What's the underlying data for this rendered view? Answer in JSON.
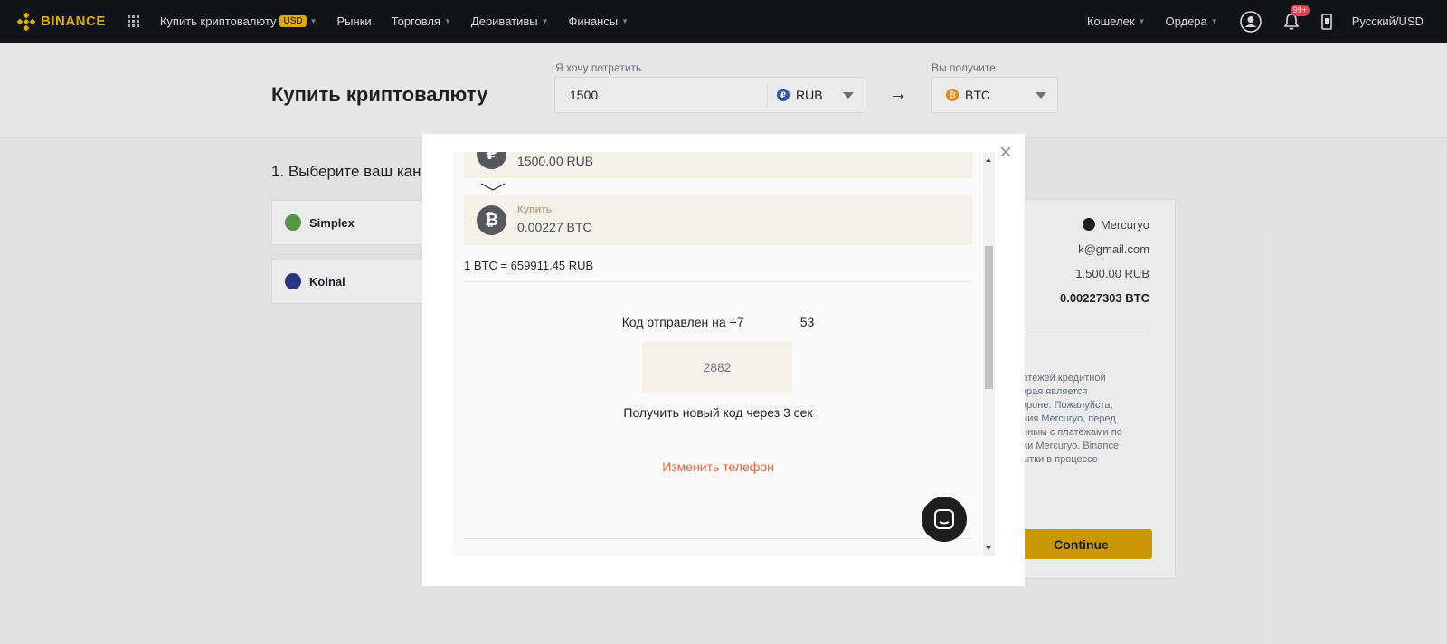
{
  "nav": {
    "logo": "BINANCE",
    "items": [
      {
        "label": "Купить криптовалюту",
        "badge": "USD"
      },
      {
        "label": "Рынки"
      },
      {
        "label": "Торговля"
      },
      {
        "label": "Деривативы"
      },
      {
        "label": "Финансы"
      }
    ],
    "right": {
      "wallet": "Кошелек",
      "orders": "Ордера",
      "notifications": "99+",
      "language": "Русский/USD"
    }
  },
  "header": {
    "title": "Купить криптовалюту",
    "spend_label": "Я хочу потратить",
    "spend_amount": "1500",
    "spend_currency": "RUB",
    "receive_label": "Вы получите",
    "receive_currency": "BTC"
  },
  "background": {
    "step_title": "1. Выберите ваш кан",
    "providers": [
      "Simplex",
      "Koinal"
    ],
    "summary": {
      "provider": "Mercuryo",
      "email": "k@gmail.com",
      "amount": "1.500.00 RUB",
      "crypto": "0.00227303 BTC",
      "disclaimer": "латежей кредитной\nторая является\nтороне. Пожалуйста,\nания Mercuryo, перед\nанным с платежами по\nжки Mercuryo. Binance\nбытки в процессе",
      "continue": "Continue"
    }
  },
  "modal": {
    "spend_value": "1500.00 RUB",
    "buy_label": "Купить",
    "buy_value": "0.00227 BTC",
    "rate": "1 BTC = 659911.45 RUB",
    "code_sent": "Код отправлен на +7                53",
    "code_value": "2882",
    "resend": "Получить новый код через 3 сек",
    "change_phone": "Изменить телефон"
  },
  "colors": {
    "nav_bg": "#12161c",
    "brand": "#f0b90b",
    "accent_link": "#e8643b",
    "coin_box": "#f5f0e8"
  }
}
